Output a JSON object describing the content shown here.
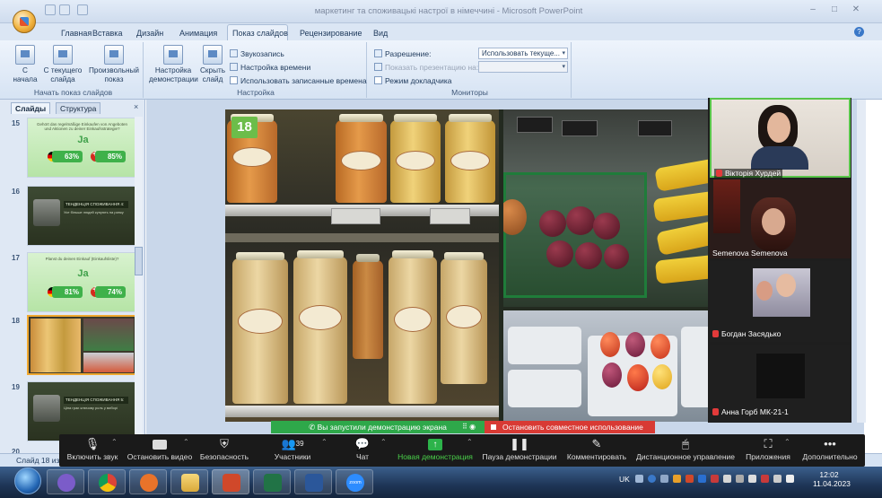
{
  "window": {
    "title": "маркетинг та споживацькі настрої в німеччині - Microsoft PowerPoint",
    "controls": [
      "–",
      "□",
      "✕"
    ]
  },
  "tabs": [
    "Главная",
    "Вставка",
    "Дизайн",
    "Анимация",
    "Показ слайдов",
    "Рецензирование",
    "Вид"
  ],
  "ribbon": {
    "start_group": {
      "label": "Начать показ слайдов",
      "from_start": "С начала",
      "from_current": "С текущего слайда",
      "custom": "Произвольный показ"
    },
    "setup_group": {
      "label": "Настройка",
      "setup_show": "Настройка демонстрации",
      "hide_slide": "Скрыть слайд",
      "record_narration": "Звукозапись",
      "rehearse": "Настройка времени",
      "use_timings": "Использовать записанные времена"
    },
    "monitors_group": {
      "label": "Мониторы",
      "resolution_label": "Разрешение:",
      "resolution_value": "Использовать текуще...",
      "show_on_label": "Показать презентацию на:",
      "presenter_view": "Режим докладчика"
    }
  },
  "left_pane": {
    "tab_slides": "Слайды",
    "tab_outline": "Структура",
    "close": "×",
    "slides": [
      {
        "num": "15",
        "style": "green",
        "tiny": "Gehört das regelmäßige Einkaufen von Angeboten und Aktionen zu deiner Einkaufsstrategie?",
        "answer": "Ja",
        "p1": "63%",
        "p2": "85%"
      },
      {
        "num": "16",
        "style": "dark",
        "bar": "ТЕНДЕНЦІЯ СПОЖИВАННЯ 4:",
        "tiny": "Усе більше людей купують на ринку"
      },
      {
        "num": "17",
        "style": "green",
        "tiny": "Planst du deinen Einkauf (Einkaufsliste)?",
        "answer": "Ja",
        "p1": "81%",
        "p2": "74%"
      },
      {
        "num": "18",
        "style": "photo"
      },
      {
        "num": "19",
        "style": "dark",
        "bar": "ТЕНДЕНЦІЯ СПОЖИВАННЯ 5:",
        "tiny": "Ціна грає ключову роль у виборі"
      },
      {
        "num": "20",
        "style": "dark"
      }
    ]
  },
  "status": {
    "slide_of": "Слайд 18 из 3"
  },
  "slide": {
    "number": "18"
  },
  "participants": [
    {
      "name": "Вікторія Хурдей",
      "mic_off": true
    },
    {
      "name": "Semenova Semenova",
      "mic_off": false
    },
    {
      "name": "Богдан Засядько",
      "mic_off": true
    },
    {
      "name": "Анна Горб МК-21-1",
      "mic_off": true
    }
  ],
  "share_bar": {
    "message": "Вы запустили демонстрацию экрана",
    "stop": "Остановить совместное использование"
  },
  "zoom_toolbar": {
    "mute": "Включить звук",
    "video": "Остановить видео",
    "security": "Безопасность",
    "participants": "Участники",
    "participants_count": "39",
    "chat": "Чат",
    "new_share": "Новая демонстрация",
    "pause_share": "Пауза демонстрации",
    "annotate": "Комментировать",
    "remote_control": "Дистанционное управление",
    "apps": "Приложения",
    "more": "Дополнительно"
  },
  "taskbar": {
    "zoom_label": "zoom",
    "lang": "UK",
    "time": "12:02",
    "date": "11.04.2023"
  },
  "colors": {
    "accent_green": "#58c54a",
    "share_green": "#2ea84a",
    "stop_red": "#d83a34",
    "ribbon_blue": "#d6e3f3"
  }
}
